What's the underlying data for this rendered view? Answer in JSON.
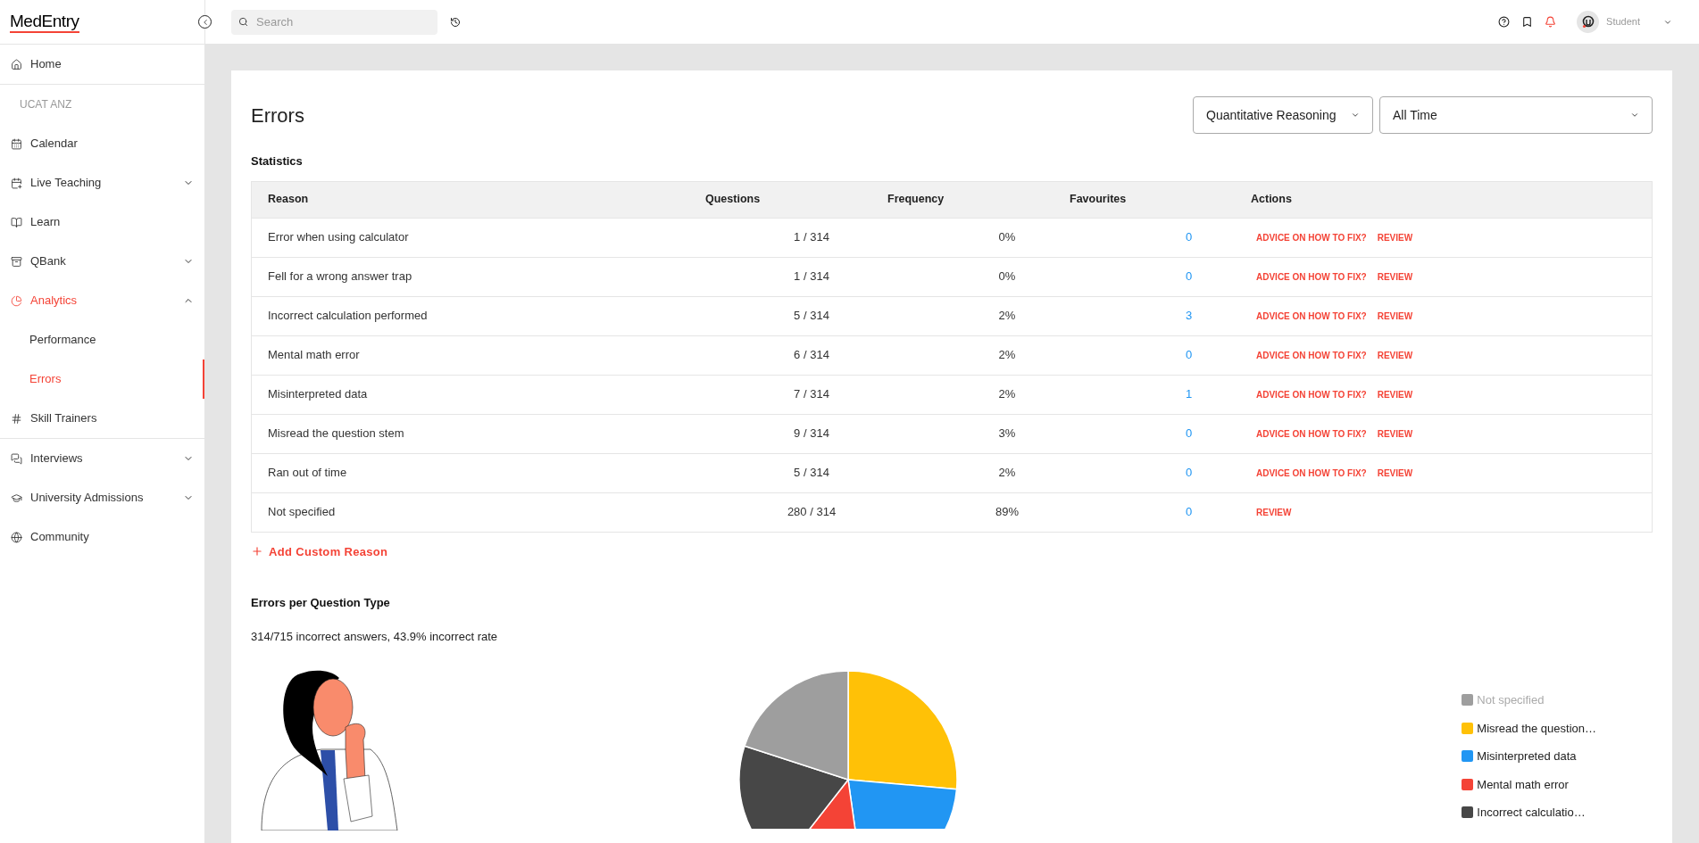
{
  "logo": {
    "text": "MedEntry"
  },
  "header": {
    "search": {
      "placeholder": "Search"
    },
    "user": {
      "name": "Student"
    }
  },
  "sidebar": {
    "groups": [
      {
        "items": [
          {
            "label": "Home",
            "selected": false
          }
        ]
      },
      {
        "heading": "UCAT ANZ",
        "items": [
          {
            "label": "Calendar",
            "selected": false
          },
          {
            "label": "Live Teaching",
            "selected": false,
            "expanded": false
          },
          {
            "label": "Learn",
            "selected": false
          },
          {
            "label": "QBank",
            "selected": false,
            "expanded": false
          },
          {
            "label": "Analytics",
            "selected": true,
            "expanded": true,
            "children": [
              {
                "label": "Performance",
                "selected": false
              },
              {
                "label": "Errors",
                "selected": true
              }
            ]
          },
          {
            "label": "Skill Trainers",
            "selected": false
          }
        ]
      },
      {
        "items": [
          {
            "label": "Interviews",
            "selected": false,
            "expanded": false
          },
          {
            "label": "University Admissions",
            "selected": false,
            "expanded": false
          },
          {
            "label": "Community",
            "selected": false
          }
        ]
      }
    ]
  },
  "page": {
    "title": "Errors",
    "filters": [
      {
        "value": "Quantitative Reasoning"
      },
      {
        "value": "All Time"
      }
    ],
    "statistics": {
      "heading": "Statistics",
      "columns": [
        "Reason",
        "Questions",
        "Frequency",
        "Favourites",
        "Actions"
      ],
      "rows": [
        {
          "reason": "Error when using calculator",
          "questions": "1 / 314",
          "frequency": "0%",
          "favourites": "0",
          "actions": [
            "ADVICE ON HOW TO FIX?",
            "REVIEW"
          ]
        },
        {
          "reason": "Fell for a wrong answer trap",
          "questions": "1 / 314",
          "frequency": "0%",
          "favourites": "0",
          "actions": [
            "ADVICE ON HOW TO FIX?",
            "REVIEW"
          ]
        },
        {
          "reason": "Incorrect calculation performed",
          "questions": "5 / 314",
          "frequency": "2%",
          "favourites": "3",
          "actions": [
            "ADVICE ON HOW TO FIX?",
            "REVIEW"
          ]
        },
        {
          "reason": "Mental math error",
          "questions": "6 / 314",
          "frequency": "2%",
          "favourites": "0",
          "actions": [
            "ADVICE ON HOW TO FIX?",
            "REVIEW"
          ]
        },
        {
          "reason": "Misinterpreted data",
          "questions": "7 / 314",
          "frequency": "2%",
          "favourites": "1",
          "actions": [
            "ADVICE ON HOW TO FIX?",
            "REVIEW"
          ]
        },
        {
          "reason": "Misread the question stem",
          "questions": "9 / 314",
          "frequency": "3%",
          "favourites": "0",
          "actions": [
            "ADVICE ON HOW TO FIX?",
            "REVIEW"
          ]
        },
        {
          "reason": "Ran out of time",
          "questions": "5 / 314",
          "frequency": "2%",
          "favourites": "0",
          "actions": [
            "ADVICE ON HOW TO FIX?",
            "REVIEW"
          ]
        },
        {
          "reason": "Not specified",
          "questions": "280 / 314",
          "frequency": "89%",
          "favourites": "0",
          "actions": [
            "REVIEW"
          ]
        }
      ],
      "add_button": "Add Custom Reason"
    },
    "errors_per_type": {
      "heading": "Errors per Question Type",
      "summary": "314/715 incorrect answers, 43.9% incorrect rate",
      "legend": [
        {
          "label": "Not specified",
          "color": "#9e9e9e",
          "hidden": true
        },
        {
          "label": "Misread the question…",
          "color": "#ffc107",
          "hidden": false
        },
        {
          "label": "Misinterpreted data",
          "color": "#2196f3",
          "hidden": false
        },
        {
          "label": "Mental math error",
          "color": "#f44336",
          "hidden": false
        },
        {
          "label": "Incorrect calculatio…",
          "color": "#474747",
          "hidden": false
        }
      ]
    }
  }
}
